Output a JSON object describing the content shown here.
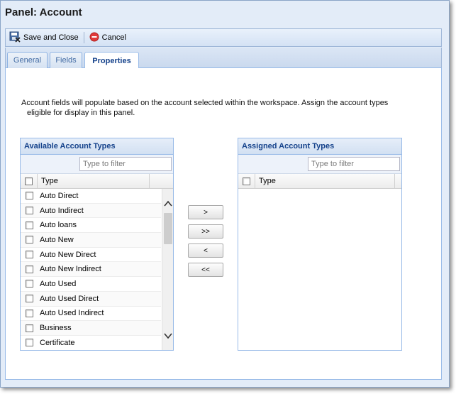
{
  "title": "Panel: Account",
  "toolbar": {
    "save_label": "Save and Close",
    "save_icon": "save-close-icon",
    "cancel_label": "Cancel",
    "cancel_icon": "cancel-icon",
    "cancel_color": "#e03a3a"
  },
  "tabs": [
    {
      "label": "General",
      "active": false
    },
    {
      "label": "Fields",
      "active": false
    },
    {
      "label": "Properties",
      "active": true
    }
  ],
  "description": {
    "line1": "Account fields will populate based on the account selected within the workspace. Assign the account types",
    "line2": "eligible for display in this panel."
  },
  "available": {
    "header": "Available Account Types",
    "filter_placeholder": "Type to filter",
    "column": "Type",
    "items": [
      "Auto Direct",
      "Auto Indirect",
      "Auto loans",
      "Auto New",
      "Auto New Direct",
      "Auto New Indirect",
      "Auto Used",
      "Auto Used Direct",
      "Auto Used Indirect",
      "Business",
      "Certificate"
    ]
  },
  "assigned": {
    "header": "Assigned Account Types",
    "filter_placeholder": "Type to filter",
    "column": "Type",
    "items": []
  },
  "move_buttons": {
    "move_right": ">",
    "move_all_right": ">>",
    "move_left": "<",
    "move_all_left": "<<"
  },
  "colors": {
    "header_text": "#15428b",
    "border": "#99bbe8"
  }
}
